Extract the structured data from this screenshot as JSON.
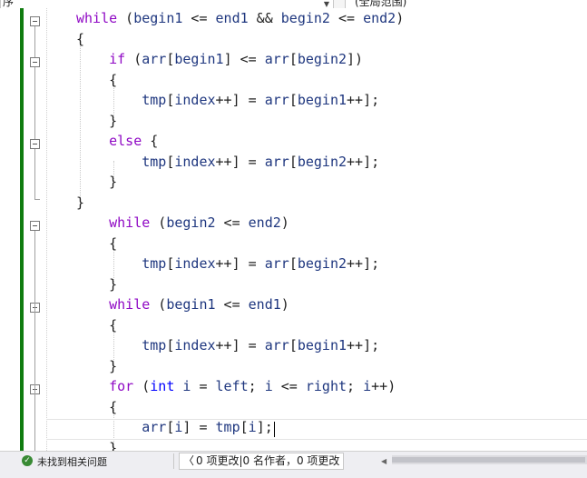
{
  "toolbar": {
    "scope_combo": "序",
    "member_combo": "(全局范围)"
  },
  "code_lines": [
    [
      {
        "t": "kw",
        "v": "while"
      },
      {
        "t": "pn",
        "v": " ("
      },
      {
        "t": "id",
        "v": "begin1"
      },
      {
        "t": "op",
        "v": " <= "
      },
      {
        "t": "id",
        "v": "end1"
      },
      {
        "t": "op",
        "v": " && "
      },
      {
        "t": "id",
        "v": "begin2"
      },
      {
        "t": "op",
        "v": " <= "
      },
      {
        "t": "id",
        "v": "end2"
      },
      {
        "t": "pn",
        "v": ")"
      }
    ],
    [
      {
        "t": "pn",
        "v": "{"
      }
    ],
    [
      {
        "t": "pn",
        "v": "    "
      },
      {
        "t": "kw",
        "v": "if"
      },
      {
        "t": "pn",
        "v": " ("
      },
      {
        "t": "id",
        "v": "arr"
      },
      {
        "t": "pn",
        "v": "["
      },
      {
        "t": "id",
        "v": "begin1"
      },
      {
        "t": "pn",
        "v": "]"
      },
      {
        "t": "op",
        "v": " <= "
      },
      {
        "t": "id",
        "v": "arr"
      },
      {
        "t": "pn",
        "v": "["
      },
      {
        "t": "id",
        "v": "begin2"
      },
      {
        "t": "pn",
        "v": "])"
      }
    ],
    [
      {
        "t": "pn",
        "v": "    {"
      }
    ],
    [
      {
        "t": "pn",
        "v": "        "
      },
      {
        "t": "id",
        "v": "tmp"
      },
      {
        "t": "pn",
        "v": "["
      },
      {
        "t": "id",
        "v": "index"
      },
      {
        "t": "op",
        "v": "++"
      },
      {
        "t": "pn",
        "v": "]"
      },
      {
        "t": "op",
        "v": " = "
      },
      {
        "t": "id",
        "v": "arr"
      },
      {
        "t": "pn",
        "v": "["
      },
      {
        "t": "id",
        "v": "begin1"
      },
      {
        "t": "op",
        "v": "++"
      },
      {
        "t": "pn",
        "v": "];"
      }
    ],
    [
      {
        "t": "pn",
        "v": "    }"
      }
    ],
    [
      {
        "t": "pn",
        "v": "    "
      },
      {
        "t": "kw",
        "v": "else"
      },
      {
        "t": "pn",
        "v": " {"
      }
    ],
    [
      {
        "t": "pn",
        "v": "        "
      },
      {
        "t": "id",
        "v": "tmp"
      },
      {
        "t": "pn",
        "v": "["
      },
      {
        "t": "id",
        "v": "index"
      },
      {
        "t": "op",
        "v": "++"
      },
      {
        "t": "pn",
        "v": "]"
      },
      {
        "t": "op",
        "v": " = "
      },
      {
        "t": "id",
        "v": "arr"
      },
      {
        "t": "pn",
        "v": "["
      },
      {
        "t": "id",
        "v": "begin2"
      },
      {
        "t": "op",
        "v": "++"
      },
      {
        "t": "pn",
        "v": "];"
      }
    ],
    [
      {
        "t": "pn",
        "v": "    }"
      }
    ],
    [
      {
        "t": "pn",
        "v": "}"
      }
    ],
    [
      {
        "t": "pn",
        "v": "    "
      },
      {
        "t": "kw",
        "v": "while"
      },
      {
        "t": "pn",
        "v": " ("
      },
      {
        "t": "id",
        "v": "begin2"
      },
      {
        "t": "op",
        "v": " <= "
      },
      {
        "t": "id",
        "v": "end2"
      },
      {
        "t": "pn",
        "v": ")"
      }
    ],
    [
      {
        "t": "pn",
        "v": "    {"
      }
    ],
    [
      {
        "t": "pn",
        "v": "        "
      },
      {
        "t": "id",
        "v": "tmp"
      },
      {
        "t": "pn",
        "v": "["
      },
      {
        "t": "id",
        "v": "index"
      },
      {
        "t": "op",
        "v": "++"
      },
      {
        "t": "pn",
        "v": "]"
      },
      {
        "t": "op",
        "v": " = "
      },
      {
        "t": "id",
        "v": "arr"
      },
      {
        "t": "pn",
        "v": "["
      },
      {
        "t": "id",
        "v": "begin2"
      },
      {
        "t": "op",
        "v": "++"
      },
      {
        "t": "pn",
        "v": "];"
      }
    ],
    [
      {
        "t": "pn",
        "v": "    }"
      }
    ],
    [
      {
        "t": "pn",
        "v": "    "
      },
      {
        "t": "kw",
        "v": "while"
      },
      {
        "t": "pn",
        "v": " ("
      },
      {
        "t": "id",
        "v": "begin1"
      },
      {
        "t": "op",
        "v": " <= "
      },
      {
        "t": "id",
        "v": "end1"
      },
      {
        "t": "pn",
        "v": ")"
      }
    ],
    [
      {
        "t": "pn",
        "v": "    {"
      }
    ],
    [
      {
        "t": "pn",
        "v": "        "
      },
      {
        "t": "id",
        "v": "tmp"
      },
      {
        "t": "pn",
        "v": "["
      },
      {
        "t": "id",
        "v": "index"
      },
      {
        "t": "op",
        "v": "++"
      },
      {
        "t": "pn",
        "v": "]"
      },
      {
        "t": "op",
        "v": " = "
      },
      {
        "t": "id",
        "v": "arr"
      },
      {
        "t": "pn",
        "v": "["
      },
      {
        "t": "id",
        "v": "begin1"
      },
      {
        "t": "op",
        "v": "++"
      },
      {
        "t": "pn",
        "v": "];"
      }
    ],
    [
      {
        "t": "pn",
        "v": "    }"
      }
    ],
    [
      {
        "t": "pn",
        "v": "    "
      },
      {
        "t": "kw",
        "v": "for"
      },
      {
        "t": "pn",
        "v": " ("
      },
      {
        "t": "kt",
        "v": "int"
      },
      {
        "t": "pn",
        "v": " "
      },
      {
        "t": "id",
        "v": "i"
      },
      {
        "t": "op",
        "v": " = "
      },
      {
        "t": "id",
        "v": "left"
      },
      {
        "t": "pn",
        "v": "; "
      },
      {
        "t": "id",
        "v": "i"
      },
      {
        "t": "op",
        "v": " <= "
      },
      {
        "t": "id",
        "v": "right"
      },
      {
        "t": "pn",
        "v": "; "
      },
      {
        "t": "id",
        "v": "i"
      },
      {
        "t": "op",
        "v": "++"
      },
      {
        "t": "pn",
        "v": ")"
      }
    ],
    [
      {
        "t": "pn",
        "v": "    {"
      }
    ],
    [
      {
        "t": "pn",
        "v": "        "
      },
      {
        "t": "id",
        "v": "arr"
      },
      {
        "t": "pn",
        "v": "["
      },
      {
        "t": "id",
        "v": "i"
      },
      {
        "t": "pn",
        "v": "]"
      },
      {
        "t": "op",
        "v": " = "
      },
      {
        "t": "id",
        "v": "tmp"
      },
      {
        "t": "pn",
        "v": "["
      },
      {
        "t": "id",
        "v": "i"
      },
      {
        "t": "pn",
        "v": "];"
      }
    ],
    [
      {
        "t": "pn",
        "v": "    }"
      }
    ]
  ],
  "colors": {
    "keyword": "#8f08c4",
    "type_keyword": "#0000ff",
    "identifier": "#1f377f",
    "punctuation": "#1e1e1e",
    "change_bar": "#107c10"
  },
  "status": {
    "issues_icon": "check-circle-icon",
    "issues_text": "未找到相关问题",
    "changes_text": "0 项更改|0 名作者，0 项更改"
  }
}
